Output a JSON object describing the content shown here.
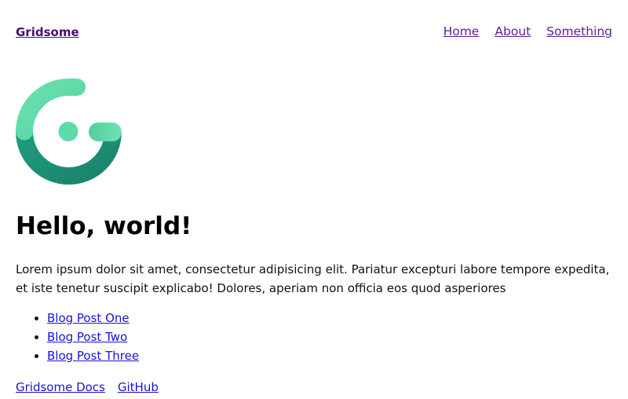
{
  "header": {
    "brand": "Gridsome",
    "nav": [
      "Home",
      "About",
      "Something"
    ]
  },
  "logo": {
    "icon": "gridsome-logo-icon",
    "colors": [
      "#5fdba7",
      "#1e8e72"
    ]
  },
  "main": {
    "title": "Hello, world!",
    "intro": "Lorem ipsum dolor sit amet, consectetur adipisicing elit. Pariatur excepturi labore tempore expedita, et iste tenetur suscipit explicabo! Dolores, aperiam non officia eos quod asperiores",
    "posts": [
      "Blog Post One",
      "Blog Post Two",
      "Blog Post Three"
    ],
    "links": [
      "Gridsome Docs",
      "GitHub"
    ]
  },
  "colors": {
    "brand": "#4b0d74",
    "link": "#1a13d6",
    "visited": "#5a1f8f"
  }
}
